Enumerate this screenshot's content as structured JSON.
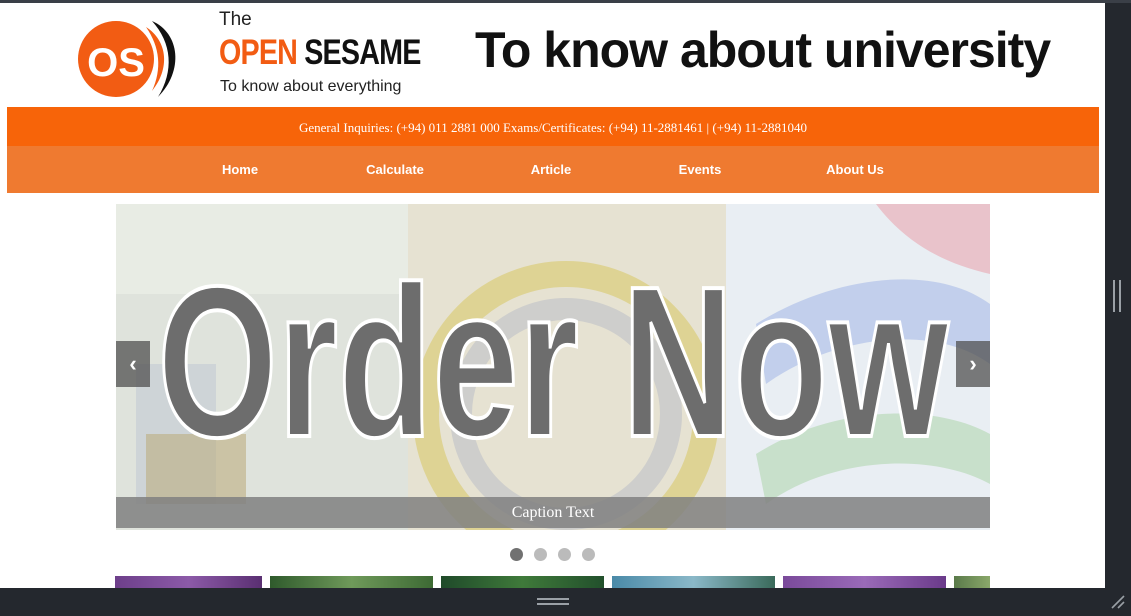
{
  "brand": {
    "logo_alt": "OS",
    "the": "The",
    "name_open": "OPEN",
    "name_sesame": "SESAME",
    "tagline": "To know about everything"
  },
  "headline": "To know about university",
  "info_bar": "General Inquiries: (+94) 011 2881 000 Exams/Certificates: (+94) 11-2881461 | (+94) 11-2881040",
  "nav": {
    "items": [
      "Home",
      "Calculate",
      "Article",
      "Events",
      "About Us"
    ]
  },
  "slider": {
    "banner_text": "Order Now",
    "caption": "Caption Text",
    "prev_label": "‹",
    "next_label": "›",
    "slide_count": 4,
    "active_slide": 1
  },
  "colors": {
    "brand_orange": "#f76409",
    "nav_orange": "#ef7a30",
    "text_dark": "#111111",
    "dot_active": "#717171",
    "dot_inactive": "#bbbbbb"
  },
  "icons": {
    "prev": "chevron-left-icon",
    "next": "chevron-right-icon",
    "resize": "resize-grip-icon"
  }
}
